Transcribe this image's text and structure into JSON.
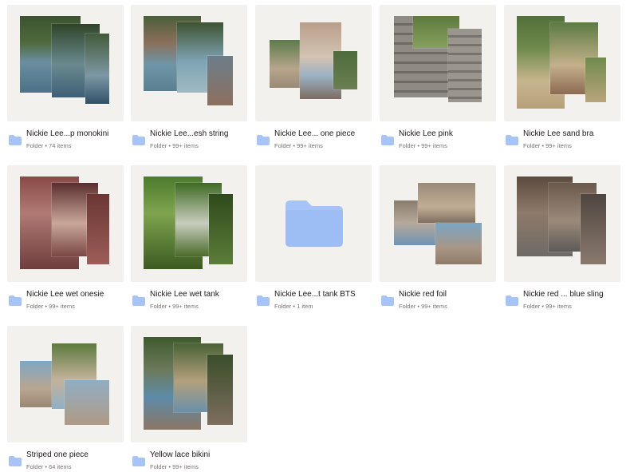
{
  "colors": {
    "folder": "#a7c4f7",
    "folder_tab": "#9dbdf5",
    "thumb_bg": "#f3f1ee",
    "text": "#1e1919",
    "subtext": "#7b7671"
  },
  "icons": {
    "folder": "folder-icon"
  },
  "folders": [
    {
      "name": "Nickie Lee...p monokini",
      "count": "74 items",
      "type": "Folder",
      "separator": "•"
    },
    {
      "name": "Nickie Lee...esh string",
      "count": "99+ items",
      "type": "Folder",
      "separator": "•"
    },
    {
      "name": "Nickie Lee... one piece",
      "count": "99+ items",
      "type": "Folder",
      "separator": "•"
    },
    {
      "name": "Nickie Lee pink",
      "count": "99+ items",
      "type": "Folder",
      "separator": "•"
    },
    {
      "name": "Nickie Lee sand bra",
      "count": "99+ items",
      "type": "Folder",
      "separator": "•"
    },
    {
      "name": "Nickie Lee wet onesie",
      "count": "99+ items",
      "type": "Folder",
      "separator": "•"
    },
    {
      "name": "Nickie Lee wet tank",
      "count": "99+ items",
      "type": "Folder",
      "separator": "•"
    },
    {
      "name": "Nickie Lee...t tank BTS",
      "count": "1 item",
      "type": "Folder",
      "separator": "•"
    },
    {
      "name": "Nickie red foil",
      "count": "99+ items",
      "type": "Folder",
      "separator": "•"
    },
    {
      "name": "Nickie red ... blue sling",
      "count": "99+ items",
      "type": "Folder",
      "separator": "•"
    },
    {
      "name": "Striped one piece",
      "count": "64 items",
      "type": "Folder",
      "separator": "•"
    },
    {
      "name": "Yellow lace bikini",
      "count": "99+ items",
      "type": "Folder",
      "separator": "•"
    }
  ]
}
